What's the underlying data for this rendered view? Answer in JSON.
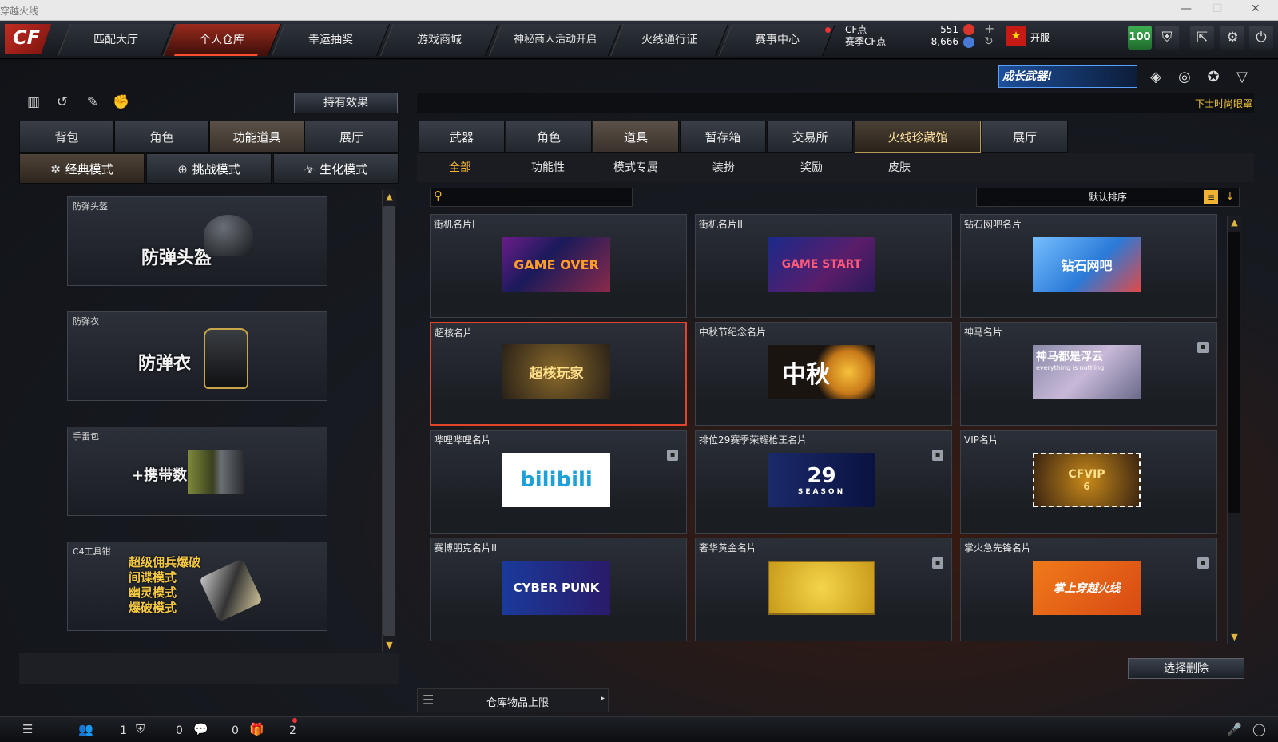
{
  "window": {
    "title": "穿越火线",
    "controls": [
      "—",
      "☐",
      "✕"
    ]
  },
  "nav": {
    "logo": "CF",
    "tabs": [
      "匹配大厅",
      "个人仓库",
      "幸运抽奖",
      "游戏商城",
      "神秘商人活动开启",
      "火线通行证",
      "赛事中心"
    ],
    "active": "个人仓库"
  },
  "currency": {
    "cf_label": "CF点",
    "cf_value": "551",
    "event_label": "赛季CF点",
    "event_value": "8,666",
    "open_label": "开服"
  },
  "topicons": {
    "level": "100",
    "shield": "shield-icon",
    "exit": "exit-icon",
    "settings": "gear-icon",
    "power": "power-icon"
  },
  "banner": {
    "text": "成长武器!"
  },
  "marquee": "下士时尚眼罩",
  "left": {
    "effect_button": "持有效果",
    "tabs": [
      "背包",
      "角色",
      "功能道具",
      "展厅"
    ],
    "active_tab": "功能道具",
    "modes": [
      "经典模式",
      "挑战模式",
      "生化模式"
    ],
    "active_mode": "经典模式",
    "items": [
      {
        "caption": "防弹头盔",
        "label": "防弹头盔"
      },
      {
        "caption": "防弹衣",
        "label": "防弹衣"
      },
      {
        "caption": "手雷包",
        "label": "+携带数"
      },
      {
        "caption": "C4工具钳",
        "label": "超级佣兵爆破\n间谍模式\n幽灵模式\n爆破模式"
      }
    ]
  },
  "right": {
    "tabs": [
      "武器",
      "角色",
      "道具",
      "暂存箱",
      "交易所",
      "火线珍藏馆",
      "展厅"
    ],
    "active_tab": "道具",
    "highlight_tab": "火线珍藏馆",
    "subtabs": [
      "全部",
      "功能性",
      "模式专属",
      "装扮",
      "奖励",
      "皮肤"
    ],
    "active_subtab": "全部",
    "sort": "默认排序",
    "cards": [
      {
        "caption": "街机名片I",
        "image": "GAME OVER"
      },
      {
        "caption": "街机名片II",
        "image": "GAME START"
      },
      {
        "caption": "钻石网吧名片",
        "image": "钻石网吧"
      },
      {
        "caption": "超核名片",
        "image": "超核玩家",
        "selected": true
      },
      {
        "caption": "中秋节纪念名片",
        "image": "中秋"
      },
      {
        "caption": "神马名片",
        "image": "神马都是浮云",
        "subimage": "everything is nothing",
        "trash": true
      },
      {
        "caption": "哔哩哔哩名片",
        "image": "bilibili",
        "trash": true
      },
      {
        "caption": "排位29赛季荣耀枪王名片",
        "image": "29",
        "subimage": "SEASON",
        "trash": true
      },
      {
        "caption": "VIP名片",
        "image": "CFVIP",
        "subimage": "6"
      },
      {
        "caption": "赛博朋克名片II",
        "image": "CYBER PUNK"
      },
      {
        "caption": "奢华黄金名片",
        "image": "",
        "trash": true
      },
      {
        "caption": "掌火急先锋名片",
        "image": "掌上穿越火线",
        "trash": true
      }
    ],
    "delete_button": "选择删除",
    "storage_label": "仓库物品上限"
  },
  "footer": {
    "counts": [
      "1",
      "0",
      "0",
      "2"
    ]
  }
}
